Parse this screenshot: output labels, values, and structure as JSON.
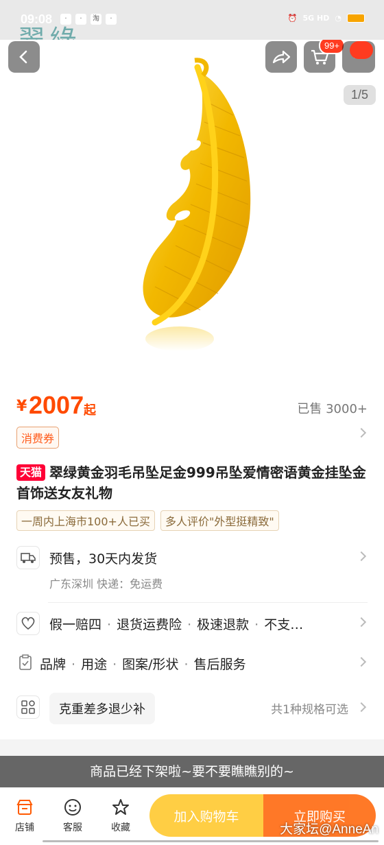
{
  "status_bar": {
    "time": "09:08",
    "network": "5G HD",
    "app_icon_taobao": "淘"
  },
  "watermark_top": "翠綠",
  "gallery": {
    "counter": "1/5",
    "cart_badge": "99+"
  },
  "price": {
    "symbol": "¥",
    "value": "2007",
    "suffix": "起",
    "sold": "已售 3000+"
  },
  "coupon": {
    "label": "消费券"
  },
  "title": {
    "badge": "天猫",
    "text": "翠绿黄金羽毛吊坠足金999吊坠爱情密语黄金挂坠金首饰送女友礼物"
  },
  "tags": [
    "一周内上海市100+人已买",
    "多人评价\"外型挺精致\""
  ],
  "shipping": {
    "main": "预售，30天内发货",
    "sub": "广东深圳  快递：免运费"
  },
  "guarantees": [
    "假一赔四",
    "退货运费险",
    "极速退款",
    "不支…"
  ],
  "params": [
    "品牌",
    "用途",
    "图案/形状",
    "售后服务"
  ],
  "specs": {
    "button": "克重差多退少补",
    "summary": "共1种规格可选"
  },
  "offline_notice": "商品已经下架啦~要不要瞧瞧别的~",
  "bottom_nav": {
    "store": "店铺",
    "service": "客服",
    "favorite": "收藏"
  },
  "cta": {
    "add_cart": "加入购物车",
    "buy_now": "立即购买"
  },
  "watermark_bottom": "大家坛@AnneAn",
  "colors": {
    "accent": "#ff4a00",
    "tmall": "#ff0036",
    "gold": "#f5c000"
  }
}
